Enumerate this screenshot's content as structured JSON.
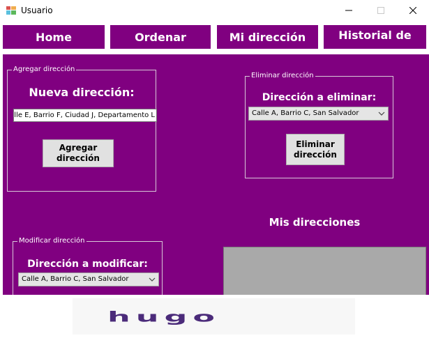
{
  "window": {
    "title": "Usuario",
    "minimize_icon": "minimize-icon",
    "maximize_icon": "maximize-icon",
    "close_icon": "close-icon"
  },
  "nav": {
    "items": [
      {
        "label": "Home"
      },
      {
        "label": "Ordenar"
      },
      {
        "label": "Mi dirección"
      },
      {
        "label": "Historial de"
      }
    ]
  },
  "add": {
    "legend": "Agregar dirección",
    "heading": "Nueva dirección:",
    "input_value": "Calle E, Barrio F, Ciudad J, Departamento L",
    "button_line1": "Agregar",
    "button_line2": "dirección"
  },
  "delete": {
    "legend": "Eliminar dirección",
    "heading": "Dirección a eliminar:",
    "selected": "Calle A, Barrio C, San Salvador",
    "button_line1": "Eliminar",
    "button_line2": "dirección"
  },
  "modify": {
    "legend": "Modificar dirección",
    "heading": "Dirección a modificar:",
    "selected": "Calle A, Barrio C, San Salvador"
  },
  "list": {
    "heading": "Mis direcciones"
  },
  "logo": {
    "text": "hugo"
  }
}
